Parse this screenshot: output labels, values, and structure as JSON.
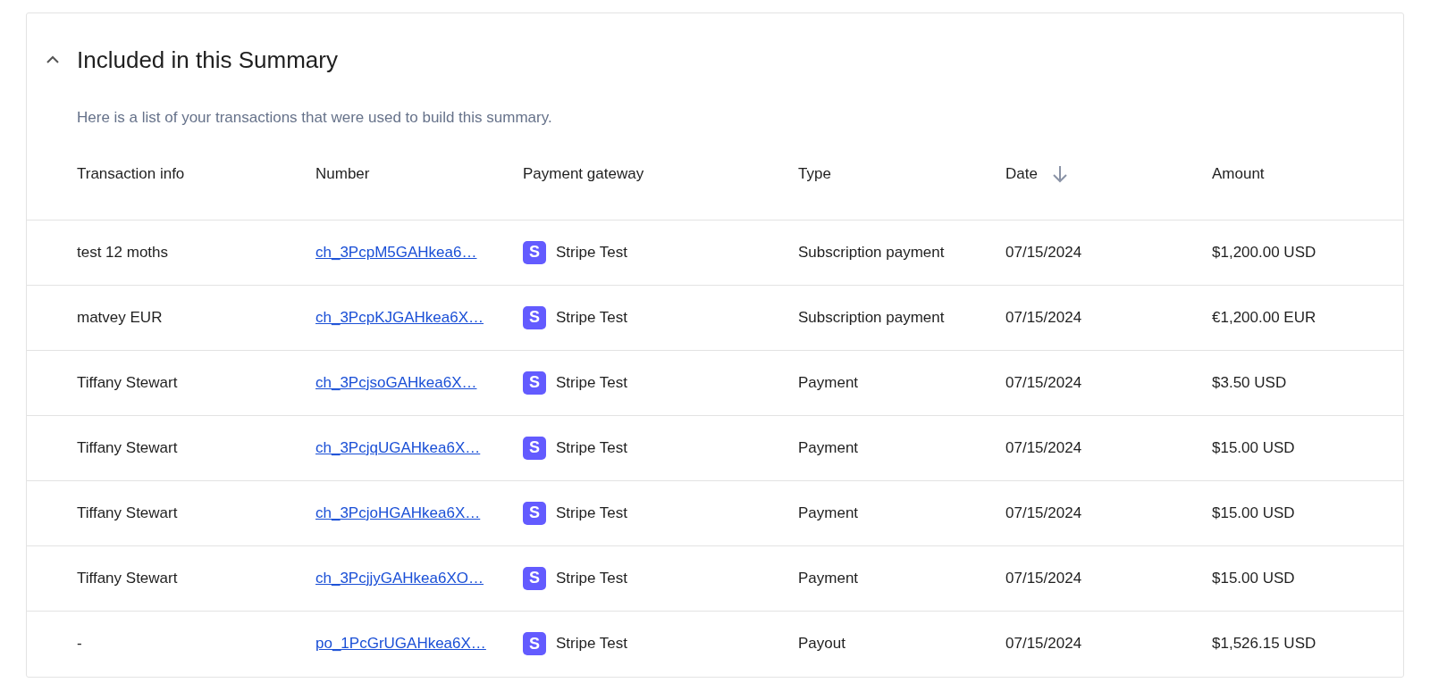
{
  "section": {
    "title": "Included in this Summary",
    "expanded": true,
    "description": "Here is a list of your transactions that were used to build this summary."
  },
  "table": {
    "columns": [
      {
        "label": "Transaction info",
        "sorted": false
      },
      {
        "label": "Number",
        "sorted": false
      },
      {
        "label": "Payment gateway",
        "sorted": false
      },
      {
        "label": "Type",
        "sorted": false
      },
      {
        "label": "Date",
        "sorted": true
      },
      {
        "label": "Amount",
        "sorted": false
      }
    ],
    "rows": [
      {
        "info": "test 12 moths",
        "number": "ch_3PcpM5GAHkea6…",
        "gateway_logo": "S",
        "gateway": "Stripe Test",
        "type": "Subscription payment",
        "date": "07/15/2024",
        "amount": "$1,200.00 USD"
      },
      {
        "info": "matvey EUR",
        "number": "ch_3PcpKJGAHkea6X…",
        "gateway_logo": "S",
        "gateway": "Stripe Test",
        "type": "Subscription payment",
        "date": "07/15/2024",
        "amount": "€1,200.00 EUR"
      },
      {
        "info": "Tiffany Stewart",
        "number": "ch_3PcjsoGAHkea6X…",
        "gateway_logo": "S",
        "gateway": "Stripe Test",
        "type": "Payment",
        "date": "07/15/2024",
        "amount": "$3.50 USD"
      },
      {
        "info": "Tiffany Stewart",
        "number": "ch_3PcjqUGAHkea6X…",
        "gateway_logo": "S",
        "gateway": "Stripe Test",
        "type": "Payment",
        "date": "07/15/2024",
        "amount": "$15.00 USD"
      },
      {
        "info": "Tiffany Stewart",
        "number": "ch_3PcjoHGAHkea6X…",
        "gateway_logo": "S",
        "gateway": "Stripe Test",
        "type": "Payment",
        "date": "07/15/2024",
        "amount": "$15.00 USD"
      },
      {
        "info": "Tiffany Stewart",
        "number": "ch_3PcjjyGAHkea6XO…",
        "gateway_logo": "S",
        "gateway": "Stripe Test",
        "type": "Payment",
        "date": "07/15/2024",
        "amount": "$15.00 USD"
      },
      {
        "info": "-",
        "number": "po_1PcGrUGAHkea6X…",
        "gateway_logo": "S",
        "gateway": "Stripe Test",
        "type": "Payout",
        "date": "07/15/2024",
        "amount": "$1,526.15 USD"
      }
    ]
  }
}
